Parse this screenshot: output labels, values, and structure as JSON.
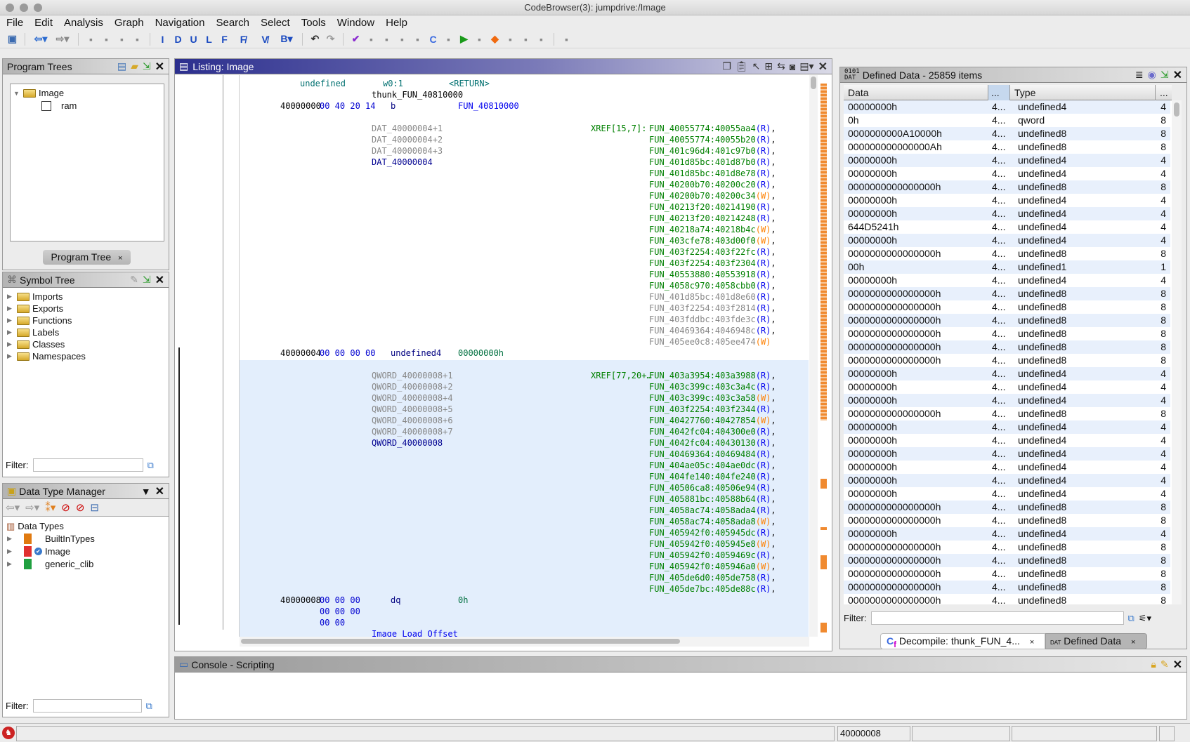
{
  "window": {
    "title": "CodeBrowser(3): jumpdrive:/Image"
  },
  "menu": [
    "File",
    "Edit",
    "Analysis",
    "Graph",
    "Navigation",
    "Search",
    "Select",
    "Tools",
    "Window",
    "Help"
  ],
  "toolbar_icons": [
    "save-icon",
    "back-icon",
    "forward-icon",
    "prev-selected-icon",
    "next-selected-icon",
    "prev-highlight-icon",
    "next-highlight-icon",
    "next-instruction-icon",
    "next-data-icon",
    "next-undefined-icon",
    "next-label-icon",
    "next-function-icon",
    "next-non-function-icon",
    "next-different-value-icon",
    "next-bookmark-icon",
    "undo-icon",
    "redo-icon",
    "checkmark-icon",
    "bytes-icon",
    "script-icon",
    "listing-icon",
    "datatype-icon",
    "decompile-icon",
    "function-graph-icon",
    "run-icon",
    "memory-icon",
    "diamond-icon",
    "table-icon",
    "export-icon",
    "tree-icon",
    "debug-icon"
  ],
  "program_trees": {
    "title": "Program Trees",
    "root": "Image",
    "child": "ram",
    "tab": "Program Tree",
    "tab_close": "×"
  },
  "symbol_tree": {
    "title": "Symbol Tree",
    "items": [
      "Imports",
      "Exports",
      "Functions",
      "Labels",
      "Classes",
      "Namespaces"
    ],
    "filter_label": "Filter:"
  },
  "data_type_manager": {
    "title": "Data Type Manager",
    "root": "Data Types",
    "items": [
      "BuiltInTypes",
      "Image",
      "generic_clib"
    ],
    "filter_label": "Filter:"
  },
  "listing": {
    "title": "Listing:  Image",
    "rows": [
      {
        "ret_type": "undefined",
        "ret_reg": "w0:1",
        "ret_label": "<RETURN>"
      },
      {
        "label": "thunk_FUN_40810000",
        "label_kind": "func"
      },
      {
        "addr": "40000000",
        "bytes": "00 40 20 14",
        "mnem": "b",
        "oper": "FUN_40810000",
        "oper_kind": "ref"
      },
      {},
      {
        "label": "DAT_40000004+1",
        "label_kind": "alias",
        "xref_head": "XREF[15,7]:",
        "xref": "FUN_40055774:40055aa4",
        "rw": "R"
      },
      {
        "label": "DAT_40000004+2",
        "label_kind": "alias",
        "xref": "FUN_40055774:40055b20",
        "rw": "R"
      },
      {
        "label": "DAT_40000004+3",
        "label_kind": "alias",
        "xref": "FUN_401c96d4:401c97b0",
        "rw": "R"
      },
      {
        "label": "DAT_40000004",
        "label_kind": "primary",
        "xref": "FUN_401d85bc:401d87b0",
        "rw": "R"
      },
      {
        "xref": "FUN_401d85bc:401d8e78",
        "rw": "R"
      },
      {
        "xref": "FUN_40200b70:40200c20",
        "rw": "R"
      },
      {
        "xref": "FUN_40200b70:40200c34",
        "rw": "W"
      },
      {
        "xref": "FUN_40213f20:40214190",
        "rw": "R"
      },
      {
        "xref": "FUN_40213f20:40214248",
        "rw": "R"
      },
      {
        "xref": "FUN_40218a74:40218b4c",
        "rw": "W"
      },
      {
        "xref": "FUN_403cfe78:403d00f0",
        "rw": "W"
      },
      {
        "xref": "FUN_403f2254:403f22fc",
        "rw": "R"
      },
      {
        "xref": "FUN_403f2254:403f2304",
        "rw": "R"
      },
      {
        "xref": "FUN_40553880:40553918",
        "rw": "R"
      },
      {
        "xref": "FUN_4058c970:4058cbb0",
        "rw": "R"
      },
      {
        "xref": "FUN_401d85bc:401d8e60",
        "rw": "R",
        "xref_kind": "indirect"
      },
      {
        "xref": "FUN_403f2254:403f2814",
        "rw": "R",
        "xref_kind": "indirect"
      },
      {
        "xref": "FUN_403fddbc:403fde3c",
        "rw": "R",
        "xref_kind": "indirect"
      },
      {
        "xref": "FUN_40469364:4046948c",
        "rw": "R",
        "xref_kind": "indirect"
      },
      {
        "xref": "FUN_405ee0c8:405ee474",
        "rw": "W",
        "xref_kind": "indirect",
        "last": true
      },
      {
        "addr": "40000004",
        "bytes": "00 00 00 00",
        "mnem": "undefined4",
        "oper": "00000000h",
        "oper_kind": "scalar"
      },
      {},
      {
        "label": "QWORD_40000008+1",
        "label_kind": "alias",
        "xref_head": "XREF[77,20+…",
        "xref": "FUN_403a3954:403a3988",
        "rw": "R"
      },
      {
        "label": "QWORD_40000008+2",
        "label_kind": "alias",
        "xref": "FUN_403c399c:403c3a4c",
        "rw": "R"
      },
      {
        "label": "QWORD_40000008+4",
        "label_kind": "alias",
        "xref": "FUN_403c399c:403c3a58",
        "rw": "W"
      },
      {
        "label": "QWORD_40000008+5",
        "label_kind": "alias",
        "xref": "FUN_403f2254:403f2344",
        "rw": "R"
      },
      {
        "label": "QWORD_40000008+6",
        "label_kind": "alias",
        "xref": "FUN_40427760:40427854",
        "rw": "W"
      },
      {
        "label": "QWORD_40000008+7",
        "label_kind": "alias",
        "xref": "FUN_4042fc04:404300e0",
        "rw": "R"
      },
      {
        "label": "QWORD_40000008",
        "label_kind": "primary",
        "xref": "FUN_4042fc04:40430130",
        "rw": "R"
      },
      {
        "xref": "FUN_40469364:40469484",
        "rw": "R"
      },
      {
        "xref": "FUN_404ae05c:404ae0dc",
        "rw": "R"
      },
      {
        "xref": "FUN_404fe140:404fe240",
        "rw": "R"
      },
      {
        "xref": "FUN_40506ca8:40506e94",
        "rw": "R"
      },
      {
        "xref": "FUN_405881bc:40588b64",
        "rw": "R"
      },
      {
        "xref": "FUN_4058ac74:4058ada4",
        "rw": "R"
      },
      {
        "xref": "FUN_4058ac74:4058ada8",
        "rw": "W"
      },
      {
        "xref": "FUN_405942f0:405945dc",
        "rw": "R"
      },
      {
        "xref": "FUN_405942f0:405945e8",
        "rw": "W"
      },
      {
        "xref": "FUN_405942f0:4059469c",
        "rw": "R"
      },
      {
        "xref": "FUN_405942f0:405946a0",
        "rw": "W"
      },
      {
        "xref": "FUN_405de6d0:405de758",
        "rw": "R"
      },
      {
        "xref": "FUN_405de7bc:405de88c",
        "rw": "R"
      },
      {
        "addr": "40000008",
        "bytes": "00 00 00",
        "mnem": "dq",
        "oper": "0h",
        "oper_kind": "scalar"
      },
      {
        "bytes": "00 00 00"
      },
      {
        "bytes": "00 00"
      },
      {
        "label": "Image Load Offset",
        "label_kind": "comment"
      }
    ]
  },
  "defined_data": {
    "title": "Defined Data - 25859 items",
    "columns": [
      "Data",
      "...",
      "Type",
      "..."
    ],
    "location_truncated": "4...",
    "rows": [
      [
        "00000000h",
        "undefined4",
        "4"
      ],
      [
        "0h",
        "qword",
        "8"
      ],
      [
        "0000000000A10000h",
        "undefined8",
        "8"
      ],
      [
        "000000000000000Ah",
        "undefined8",
        "8"
      ],
      [
        "00000000h",
        "undefined4",
        "4"
      ],
      [
        "00000000h",
        "undefined4",
        "4"
      ],
      [
        "0000000000000000h",
        "undefined8",
        "8"
      ],
      [
        "00000000h",
        "undefined4",
        "4"
      ],
      [
        "00000000h",
        "undefined4",
        "4"
      ],
      [
        "644D5241h",
        "undefined4",
        "4"
      ],
      [
        "00000000h",
        "undefined4",
        "4"
      ],
      [
        "0000000000000000h",
        "undefined8",
        "8"
      ],
      [
        "00h",
        "undefined1",
        "1"
      ],
      [
        "00000000h",
        "undefined4",
        "4"
      ],
      [
        "0000000000000000h",
        "undefined8",
        "8"
      ],
      [
        "0000000000000000h",
        "undefined8",
        "8"
      ],
      [
        "0000000000000000h",
        "undefined8",
        "8"
      ],
      [
        "0000000000000000h",
        "undefined8",
        "8"
      ],
      [
        "0000000000000000h",
        "undefined8",
        "8"
      ],
      [
        "0000000000000000h",
        "undefined8",
        "8"
      ],
      [
        "00000000h",
        "undefined4",
        "4"
      ],
      [
        "00000000h",
        "undefined4",
        "4"
      ],
      [
        "00000000h",
        "undefined4",
        "4"
      ],
      [
        "0000000000000000h",
        "undefined8",
        "8"
      ],
      [
        "00000000h",
        "undefined4",
        "4"
      ],
      [
        "00000000h",
        "undefined4",
        "4"
      ],
      [
        "00000000h",
        "undefined4",
        "4"
      ],
      [
        "00000000h",
        "undefined4",
        "4"
      ],
      [
        "00000000h",
        "undefined4",
        "4"
      ],
      [
        "00000000h",
        "undefined4",
        "4"
      ],
      [
        "0000000000000000h",
        "undefined8",
        "8"
      ],
      [
        "0000000000000000h",
        "undefined8",
        "8"
      ],
      [
        "00000000h",
        "undefined4",
        "4"
      ],
      [
        "0000000000000000h",
        "undefined8",
        "8"
      ],
      [
        "0000000000000000h",
        "undefined8",
        "8"
      ],
      [
        "0000000000000000h",
        "undefined8",
        "8"
      ],
      [
        "0000000000000000h",
        "undefined8",
        "8"
      ],
      [
        "0000000000000000h",
        "undefined8",
        "8"
      ]
    ],
    "filter_label": "Filter:",
    "tabs": [
      {
        "label": "Decompile: thunk_FUN_4...",
        "close": "×"
      },
      {
        "label": "Defined Data",
        "close": "×"
      }
    ]
  },
  "console": {
    "title": "Console - Scripting"
  },
  "status": {
    "address": "40000008"
  },
  "colors": {
    "listing_header": "#2c2f8e",
    "selection_bg": "#e3eefc",
    "xref_green": "#008000",
    "ref_blue": "#0000ee",
    "write_orange": "#ff8000",
    "alt_row": "#e8f0fc"
  }
}
